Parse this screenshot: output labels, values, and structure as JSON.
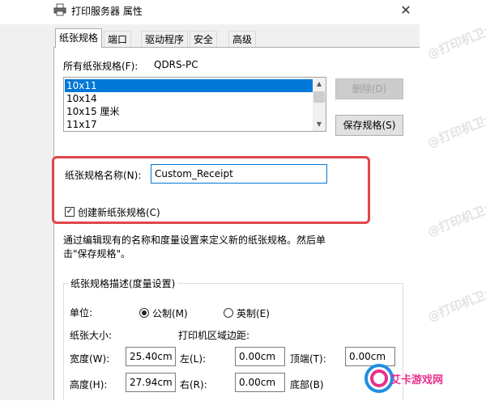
{
  "window": {
    "title": "打印服务器 属性",
    "close_glyph": "✕"
  },
  "tabs": [
    {
      "label": "纸张规格",
      "active": true
    },
    {
      "label": "端口",
      "active": false
    },
    {
      "label": "驱动程序",
      "active": false
    },
    {
      "label": "安全",
      "active": false
    },
    {
      "label": "高级",
      "active": false
    }
  ],
  "forms": {
    "label": "所有纸张规格(F):",
    "server": "QDRS-PC",
    "items": [
      "10x11",
      "10x14",
      "10x15 厘米",
      "11x17"
    ],
    "selected_index": 0
  },
  "buttons": {
    "delete": "删除(D)",
    "save": "保存规格(S)"
  },
  "form_name": {
    "label": "纸张规格名称(N):",
    "value": "Custom_Receipt"
  },
  "create_new": {
    "label": "创建新纸张规格(C)",
    "checked": true,
    "check_glyph": "✓"
  },
  "instructions": {
    "line1": "通过编辑现有的名称和度量设置来定义新的纸张规格。然后单",
    "line2": "击\"保存规格\"。"
  },
  "description": {
    "title": "纸张规格描述(度量设置)",
    "units_label": "单位:",
    "metric": "公制(M)",
    "imperial": "英制(E)",
    "metric_selected": true,
    "paper_size_label": "纸张大小:",
    "margins_label": "打印机区域边距:",
    "width_label": "宽度(W):",
    "width_value": "25.40cm",
    "height_label": "高度(H):",
    "height_value": "27.94cm",
    "left_label": "左(L):",
    "left_value": "0.00cm",
    "right_label": "右(R):",
    "right_value": "0.00cm",
    "top_label": "顶端(T):",
    "top_value": "0.00cm",
    "bottom_label": "底部(B)"
  },
  "watermark": {
    "text": "@打印机卫士"
  },
  "logo": {
    "text": "艾卡游戏网",
    "colors": {
      "pink": "#e8308c",
      "blue": "#1f8fe0"
    }
  },
  "colors": {
    "accent": "#0078d7",
    "highlight": "#e0464a"
  }
}
